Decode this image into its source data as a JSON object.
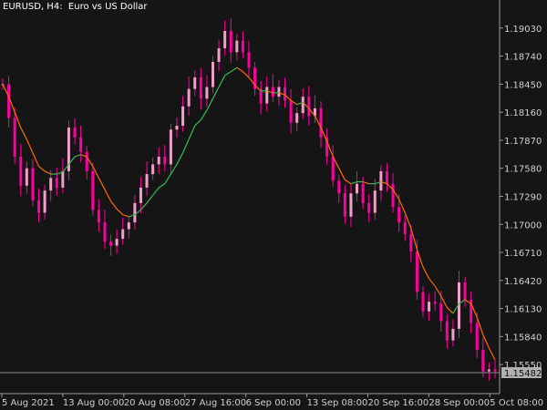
{
  "header": {
    "symbol": "EURUSD, H4:",
    "description": "Euro vs US Dollar"
  },
  "colors": {
    "background": "#151515",
    "axis": "#9a9a9a",
    "candle": "#ff00a0",
    "ma_up": "#2fbf55",
    "ma_down": "#ff6a00",
    "price_line": "#8a8a8a",
    "price_tag": "#b0b0b0"
  },
  "chart_data": {
    "type": "line",
    "ylim": [
      1.1525,
      1.1932
    ],
    "yticks": [
      "1.19030",
      "1.18740",
      "1.18450",
      "1.18160",
      "1.17870",
      "1.17580",
      "1.17290",
      "1.17000",
      "1.16710",
      "1.16420",
      "1.16130",
      "1.15840",
      "1.15550"
    ],
    "xticks": [
      "5 Aug 2021",
      "13 Aug 00:00",
      "20 Aug 08:00",
      "27 Aug 16:00",
      "6 Sep 00:00",
      "13 Sep 08:00",
      "20 Sep 16:00",
      "28 Sep 00:00",
      "5 Oct 08:00"
    ],
    "current_price": "1.15482",
    "series": [
      {
        "role": "price",
        "values": [
          1.1845,
          1.181,
          1.177,
          1.174,
          1.1758,
          1.1725,
          1.1712,
          1.1735,
          1.1748,
          1.1738,
          1.1755,
          1.18,
          1.179,
          1.1775,
          1.1755,
          1.1715,
          1.1702,
          1.1682,
          1.1678,
          1.1685,
          1.1695,
          1.1702,
          1.1722,
          1.1738,
          1.1752,
          1.1762,
          1.177,
          1.1762,
          1.1798,
          1.1802,
          1.1822,
          1.184,
          1.1852,
          1.183,
          1.1842,
          1.1868,
          1.1882,
          1.19,
          1.1878,
          1.189,
          1.1878,
          1.1862,
          1.184,
          1.1825,
          1.1842,
          1.1832,
          1.1842,
          1.1828,
          1.1805,
          1.1815,
          1.1832,
          1.1812,
          1.182,
          1.179,
          1.177,
          1.1745,
          1.1732,
          1.1708,
          1.1732,
          1.1742,
          1.1722,
          1.1712,
          1.1735,
          1.1755,
          1.1742,
          1.1718,
          1.1702,
          1.169,
          1.1672,
          1.163,
          1.161,
          1.162,
          1.1618,
          1.16,
          1.158,
          1.1592,
          1.164,
          1.1622,
          1.1598,
          1.157,
          1.1548,
          1.155,
          1.1548
        ],
        "overlay_ma": [
          1.1845,
          1.1832,
          1.1816,
          1.18,
          1.1788,
          1.1774,
          1.176,
          1.1755,
          1.1752,
          1.1752,
          1.1754,
          1.1762,
          1.177,
          1.1772,
          1.177,
          1.176,
          1.1748,
          1.1736,
          1.1724,
          1.1716,
          1.171,
          1.1708,
          1.171,
          1.1715,
          1.1722,
          1.173,
          1.1738,
          1.1742,
          1.1752,
          1.1762,
          1.1774,
          1.1788,
          1.1802,
          1.1808,
          1.1818,
          1.183,
          1.1842,
          1.1854,
          1.1858,
          1.1862,
          1.1858,
          1.1852,
          1.1844,
          1.1838,
          1.1838,
          1.1836,
          1.1836,
          1.1834,
          1.1828,
          1.1824,
          1.1826,
          1.182,
          1.1812,
          1.18,
          1.1786,
          1.177,
          1.1758,
          1.1746,
          1.1742,
          1.1744,
          1.1744,
          1.1742,
          1.1742,
          1.1744,
          1.1742,
          1.1736,
          1.1726,
          1.1712,
          1.1696,
          1.1674,
          1.1656,
          1.1644,
          1.1636,
          1.1626,
          1.1614,
          1.1608,
          1.1618,
          1.1622,
          1.1618,
          1.1604,
          1.1586,
          1.1572,
          1.156
        ]
      }
    ]
  }
}
